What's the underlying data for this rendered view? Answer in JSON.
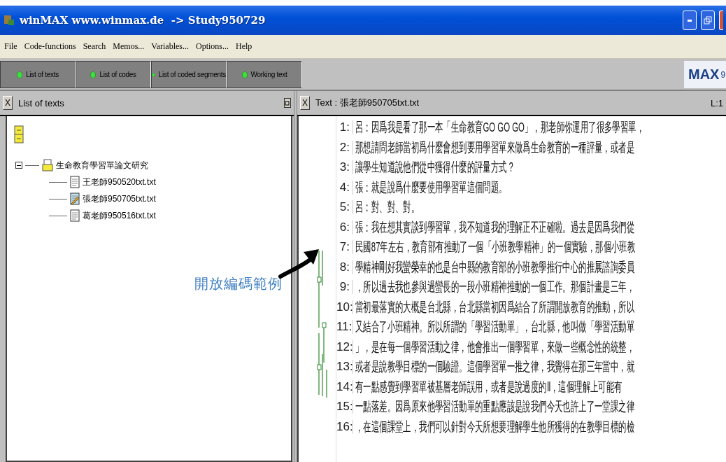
{
  "window": {
    "title": "winMAX www.winmax.de  -> Study950729"
  },
  "menu": [
    "File",
    "Code-functions",
    "Search",
    "Memos...",
    "Variables...",
    "Options...",
    "Help"
  ],
  "toolbar": {
    "tabs": [
      {
        "label": "List of texts"
      },
      {
        "label": "List of codes"
      },
      {
        "label": "List of coded segments"
      },
      {
        "label": "Working text"
      }
    ],
    "logo": "MAX",
    "logo_suffix": "9"
  },
  "left_panel": {
    "close": "X",
    "title": "List of texts",
    "project": {
      "label": "生命教育學習單論文研究",
      "expanded": true,
      "children": [
        {
          "label": "王老師950520txt.txt",
          "kind": "document"
        },
        {
          "label": "張老師950705txt.txt",
          "kind": "open-document"
        },
        {
          "label": "葛老師950516txt.txt",
          "kind": "document"
        }
      ]
    }
  },
  "annotation": {
    "label": "開放編碼範例"
  },
  "right_panel": {
    "close": "X",
    "title": "Text : 張老師950705txt.txt",
    "position": "L:1",
    "lines": [
      {
        "number": "1:",
        "text": "呂：因爲我是看了那一本「生命教育GO GO GO」，那老師你運用了很多學習單，"
      },
      {
        "number": "2:",
        "text": "那想請問老師當初爲什麼會想到要用學習單來做爲生命教育的一種評量，或者是"
      },
      {
        "number": "3:",
        "text": "讓學生知道說他們從中獲得什麼的評量方式？"
      },
      {
        "number": "4:",
        "text": "張：就是說爲什麼要使用學習單這個問題。"
      },
      {
        "number": "5:",
        "text": "呂：對、對、對。"
      },
      {
        "number": "6:",
        "text": "張：我在想其實談到學習單，我不知道我的理解正不正確啦。過去是因爲我們從"
      },
      {
        "number": "7:",
        "text": "民國87年左右，教育部有推動了一個「小班教學精神」的一個實驗，那個小班教"
      },
      {
        "number": "8:",
        "text": "學精神剛好我蠻榮幸的也是台中縣的教育部的小班教學推行中心的推展諮詢委員"
      },
      {
        "number": "9:",
        "text": "，所以過去我也參與過蠻長的一段小班精神推動的一個工作。那個計畫是三年，"
      },
      {
        "number": "10:",
        "text": "當初最落實的大概是台北縣，台北縣當初因爲結合了所謂開放教育的推動，所以"
      },
      {
        "number": "11:",
        "text": "又結合了小班精神。所以所謂的「學習活動單」，台北縣，他叫做「學習活動單"
      },
      {
        "number": "12:",
        "text": "」，是在每一個學習活動之律，他會推出一個學習單，來做一些概念性的統整，"
      },
      {
        "number": "13:",
        "text": "或者是說教學目標的一個驗證。這個學習單一推之律，我覺得在那三年當中，就"
      },
      {
        "number": "14:",
        "text": "有一點感覺到學習單被基層老師誤用，或者是說過度的Ⅱ，這個理解上可能有"
      },
      {
        "number": "15:",
        "text": "一點落差。因爲原來他學習活動單的重點應該是說我們今天也許上了一堂課之律"
      },
      {
        "number": "16:",
        "text": "，在這個課堂上，我們可以針對今天所想要理解學生他所獲得的在教學目標的檢"
      }
    ]
  }
}
